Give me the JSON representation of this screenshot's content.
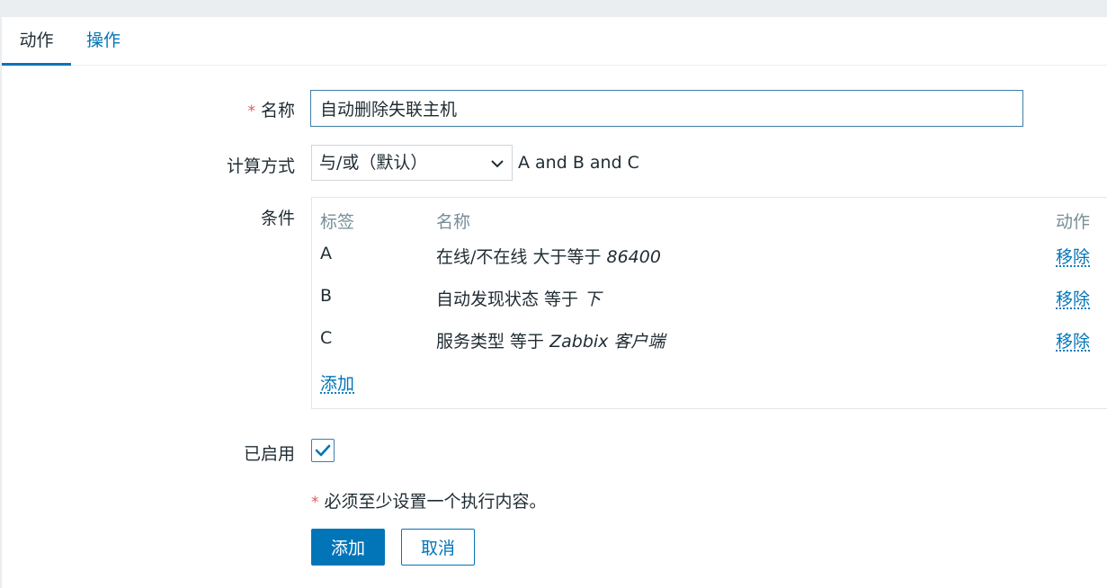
{
  "tabs": [
    {
      "label": "动作"
    },
    {
      "label": "操作"
    }
  ],
  "form": {
    "name_label": "名称",
    "name_value": "自动删除失联主机",
    "calc_label": "计算方式",
    "calc_value": "与/或（默认）",
    "calc_formula": "A and B and C",
    "conditions_label": "条件",
    "enabled_label": "已启用",
    "enabled": true,
    "required_mark": "*"
  },
  "conditions": {
    "headers": {
      "tag": "标签",
      "name": "名称",
      "action": "动作"
    },
    "rows": [
      {
        "tag": "A",
        "name_text": "在线/不在线 大于等于 ",
        "name_value": "86400",
        "remove": "移除"
      },
      {
        "tag": "B",
        "name_text": "自动发现状态 等于 ",
        "name_value": "下",
        "remove": "移除"
      },
      {
        "tag": "C",
        "name_text": "服务类型 等于 ",
        "name_value": "Zabbix 客户端",
        "remove": "移除"
      }
    ],
    "add_label": "添加"
  },
  "note": "必须至少设置一个执行内容。",
  "buttons": {
    "add": "添加",
    "cancel": "取消"
  },
  "colors": {
    "accent": "#0275b8",
    "required": "#e45959",
    "header_text": "#768d99"
  }
}
